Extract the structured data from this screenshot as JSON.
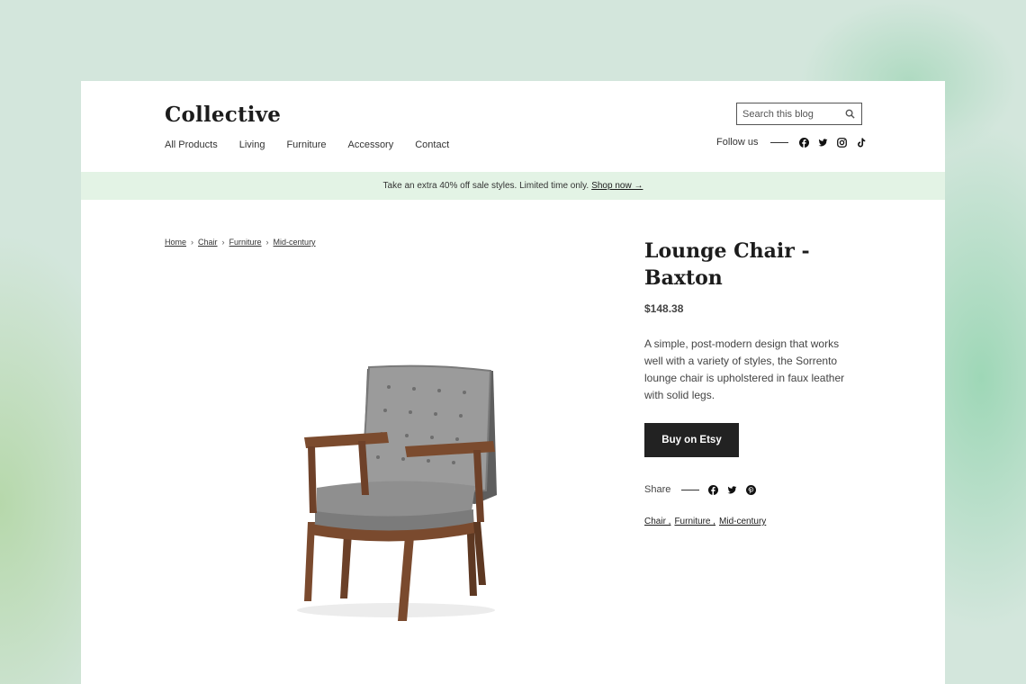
{
  "brand": {
    "logo": "Collective"
  },
  "nav": {
    "items": [
      "All Products",
      "Living",
      "Furniture",
      "Accessory",
      "Contact"
    ]
  },
  "search": {
    "placeholder": "Search this blog",
    "icon": "search-icon"
  },
  "follow": {
    "label": "Follow us",
    "icons": [
      "facebook-icon",
      "twitter-icon",
      "instagram-icon",
      "tiktok-icon"
    ]
  },
  "banner": {
    "text": "Take an extra 40% off sale styles. Limited time only.",
    "link": "Shop now →"
  },
  "breadcrumb": {
    "items": [
      "Home",
      "Chair",
      "Furniture",
      "Mid-century"
    ],
    "separator": "›"
  },
  "product": {
    "title": "Lounge Chair - Baxton",
    "price": "$148.38",
    "description": "A simple, post-modern design that works well with a variety of styles, the Sorrento lounge chair is upholstered in faux leather with solid legs.",
    "buy_label": "Buy on Etsy"
  },
  "share": {
    "label": "Share",
    "icons": [
      "facebook-icon",
      "twitter-icon",
      "pinterest-icon"
    ]
  },
  "tags": [
    "Chair ,",
    "Furniture ,",
    "Mid-century"
  ],
  "colors": {
    "banner_bg": "#e3f3e5",
    "button_bg": "#222222",
    "page_bg": "#d3e6dc"
  }
}
